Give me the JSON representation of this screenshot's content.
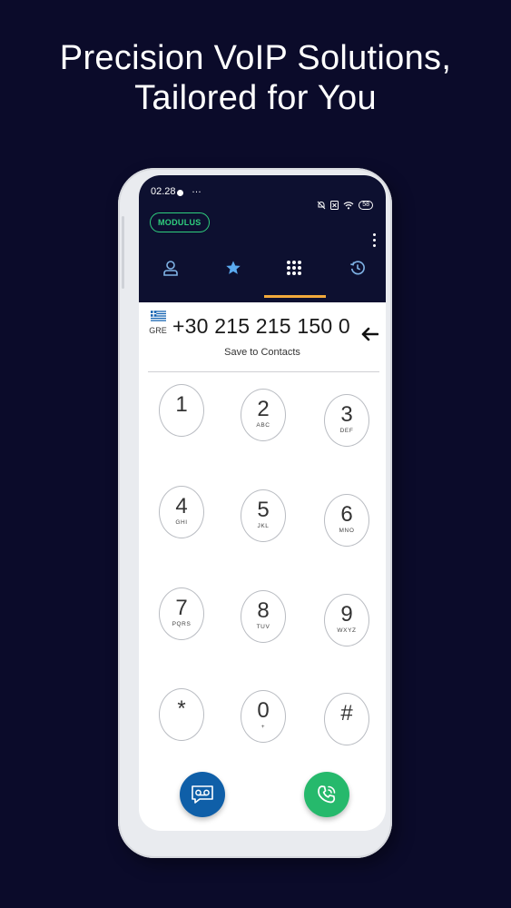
{
  "headline": {
    "line1": "Precision VoIP Solutions,",
    "line2": "Tailored for You"
  },
  "status_bar": {
    "time": "02.28",
    "more": "…",
    "battery": "58"
  },
  "app": {
    "brand": "MODULUS",
    "tabs": [
      {
        "icon": "contacts-icon"
      },
      {
        "icon": "favorites-star-icon"
      },
      {
        "icon": "dialpad-grid-icon",
        "active": true
      },
      {
        "icon": "recent-history-icon"
      }
    ],
    "colors": {
      "app_bar": "#0d1030",
      "accent_tab": "#f2a93b",
      "brand_green": "#2fd07e",
      "voicemail_button": "#0f5fa8",
      "call_button": "#26b96c"
    }
  },
  "dialer": {
    "country_code": "GRE",
    "number": "+30 215 215 150 0",
    "save_label": "Save to Contacts",
    "keys": [
      {
        "digit": "1",
        "letters": ""
      },
      {
        "digit": "2",
        "letters": "ABC"
      },
      {
        "digit": "3",
        "letters": "DEF"
      },
      {
        "digit": "4",
        "letters": "GHI"
      },
      {
        "digit": "5",
        "letters": "JKL"
      },
      {
        "digit": "6",
        "letters": "MNO"
      },
      {
        "digit": "7",
        "letters": "PQRS"
      },
      {
        "digit": "8",
        "letters": "TUV"
      },
      {
        "digit": "9",
        "letters": "WXYZ"
      },
      {
        "digit": "*",
        "letters": ""
      },
      {
        "digit": "0",
        "letters": "+"
      },
      {
        "digit": "#",
        "letters": ""
      }
    ]
  }
}
